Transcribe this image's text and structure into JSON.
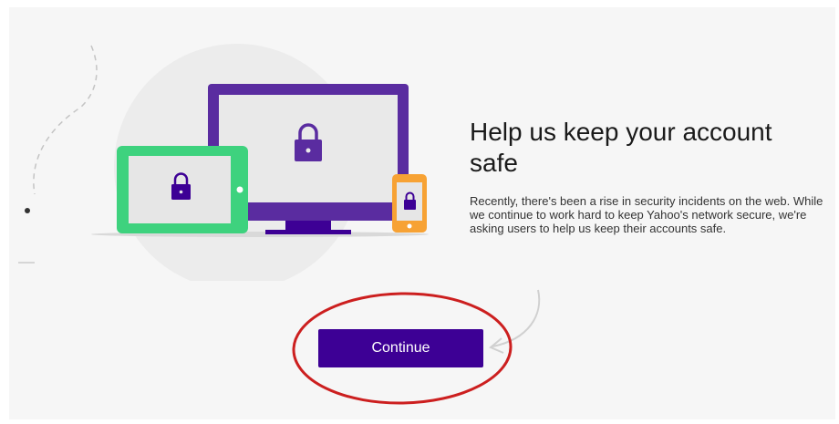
{
  "heading": "Help us keep your account safe",
  "description": "Recently, there's been a rise in security incidents on the web. While we continue to work hard to keep Yahoo's network secure, we're asking users to help us keep their accounts safe.",
  "continue_button": {
    "label": "Continue"
  },
  "illustration": {
    "icons": [
      "tablet-icon",
      "monitor-icon",
      "smartphone-icon",
      "lock-icon"
    ]
  },
  "colors": {
    "brand_purple": "#3d0095",
    "monitor_purple": "#5a2ca0",
    "tablet_green": "#3ed27e",
    "phone_orange": "#f7a234",
    "annotation_red": "#cc1f1f",
    "background": "#f6f6f6"
  }
}
